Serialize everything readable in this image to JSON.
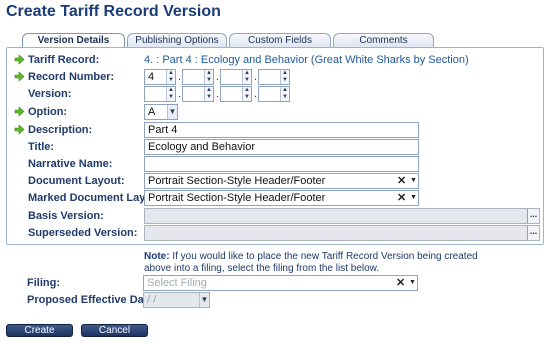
{
  "page": {
    "title": "Create Tariff Record Version"
  },
  "tabs": [
    {
      "label": "Version Details"
    },
    {
      "label": "Publishing Options"
    },
    {
      "label": "Custom Fields"
    },
    {
      "label": "Comments"
    }
  ],
  "fields": {
    "tariff_record": {
      "label": "Tariff Record:",
      "value": "4. : Part 4 : Ecology and Behavior (Great White Sharks by Section)"
    },
    "record_number": {
      "label": "Record Number:",
      "segments": [
        "4",
        "",
        "",
        ""
      ]
    },
    "version": {
      "label": "Version:",
      "segments": [
        "",
        "",
        "",
        ""
      ]
    },
    "option": {
      "label": "Option:",
      "value": "A"
    },
    "description": {
      "label": "Description:",
      "value": "Part 4"
    },
    "title": {
      "label": "Title:",
      "value": "Ecology and Behavior"
    },
    "narrative_name": {
      "label": "Narrative Name:",
      "value": ""
    },
    "document_layout": {
      "label": "Document Layout:",
      "value": "Portrait Section-Style Header/Footer"
    },
    "marked_document_layout": {
      "label": "Marked Document Layout:",
      "value": "Portrait Section-Style Header/Footer"
    },
    "basis_version": {
      "label": "Basis Version:",
      "value": ""
    },
    "superseded_version": {
      "label": "Superseded Version:",
      "value": ""
    }
  },
  "note": {
    "prefix": "Note:",
    "text": " If you would like to place the new Tariff Record Version being created above into a filing, select the filing from the list below."
  },
  "filing": {
    "label": "Filing:",
    "placeholder": "Select Filing"
  },
  "proposed_effective_date": {
    "label": "Proposed Effective Date:",
    "value": " /  / "
  },
  "buttons": {
    "create": "Create",
    "cancel": "Cancel"
  },
  "icons": {
    "required": "green-arrow-icon",
    "clear": "clear-x-icon",
    "dropdown": "dropdown-arrow-icon",
    "browse": "ellipsis-icon"
  },
  "colors": {
    "accent": "#1a3c78",
    "required_arrow": "#4caf1e",
    "button": "#1c3362"
  }
}
